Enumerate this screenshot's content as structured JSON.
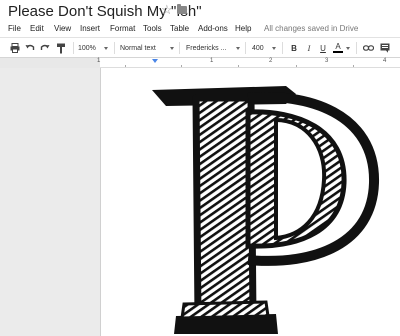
{
  "title": "Please Don't Squish My \"Ish\"",
  "menu": [
    "File",
    "Edit",
    "View",
    "Insert",
    "Format",
    "Tools",
    "Table",
    "Add-ons",
    "Help"
  ],
  "save_status": "All changes saved in Drive",
  "toolbar": {
    "zoom": "100%",
    "style": "Normal text",
    "font": "Fredericks ...",
    "size": "400",
    "bold": "B",
    "italic": "I",
    "underline": "U",
    "text_color": "A"
  },
  "ruler": [
    "1",
    "1",
    "2",
    "3",
    "4"
  ],
  "icons": {
    "star": "star-icon",
    "folder": "folder-icon",
    "print": "print-icon",
    "undo": "undo-icon",
    "redo": "redo-icon",
    "paint_format": "paint-format-icon",
    "link": "link-icon",
    "comment": "comment-icon"
  }
}
